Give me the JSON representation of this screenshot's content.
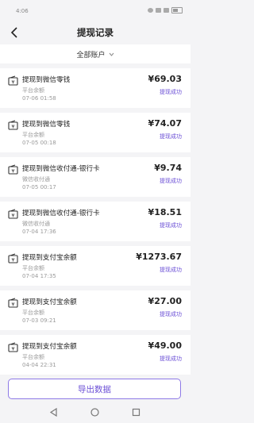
{
  "status_bar": {
    "time": "4:06"
  },
  "header": {
    "title": "提现记录"
  },
  "filter": {
    "label": "全部账户"
  },
  "records": [
    {
      "title": "提现到微信零钱",
      "source": "平台余额",
      "time": "07-06 01:58",
      "amount": "¥69.03",
      "status": "提现成功"
    },
    {
      "title": "提现到微信零钱",
      "source": "平台余额",
      "time": "07-05 00:18",
      "amount": "¥74.07",
      "status": "提现成功"
    },
    {
      "title": "提现到微信收付通-银行卡",
      "source": "微信收付通",
      "time": "07-05 00:17",
      "amount": "¥9.74",
      "status": "提现成功"
    },
    {
      "title": "提现到微信收付通-银行卡",
      "source": "微信收付通",
      "time": "07-04 17:36",
      "amount": "¥18.51",
      "status": "提现成功"
    },
    {
      "title": "提现到支付宝余额",
      "source": "平台余额",
      "time": "07-04 17:35",
      "amount": "¥1273.67",
      "status": "提现成功"
    },
    {
      "title": "提现到支付宝余额",
      "source": "平台余额",
      "time": "07-03 09:21",
      "amount": "¥27.00",
      "status": "提现成功"
    },
    {
      "title": "提现到支付宝余额",
      "source": "平台余额",
      "time": "04-04 22:31",
      "amount": "¥49.00",
      "status": "提现成功"
    }
  ],
  "export_button": {
    "label": "导出数据"
  },
  "colors": {
    "accent": "#6b4fd6",
    "background": "#f4f4f6",
    "card": "#ffffff"
  }
}
